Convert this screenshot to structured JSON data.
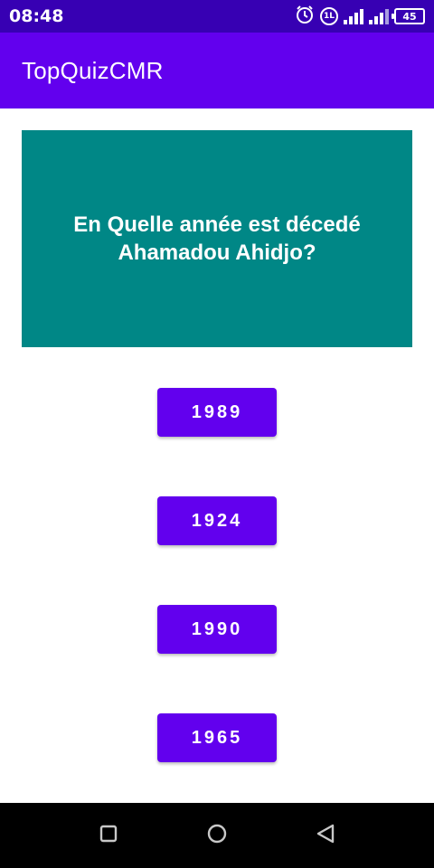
{
  "status_bar": {
    "time": "08:48",
    "battery_level": "45",
    "icons": [
      "alarm-icon",
      "data-saver-icon",
      "signal-icon",
      "signal-icon",
      "battery-icon"
    ],
    "data_saver_text": "1L"
  },
  "app_bar": {
    "title": "TopQuizCMR",
    "color": "#6200ee"
  },
  "question": {
    "text": "En Quelle année est décedé Ahamadou Ahidjo?",
    "background": "#008786"
  },
  "answers": [
    {
      "label": "1989"
    },
    {
      "label": "1924"
    },
    {
      "label": "1990"
    },
    {
      "label": "1965"
    }
  ],
  "nav_bar": {
    "icons": [
      "recent-apps-icon",
      "home-icon",
      "back-icon"
    ]
  }
}
